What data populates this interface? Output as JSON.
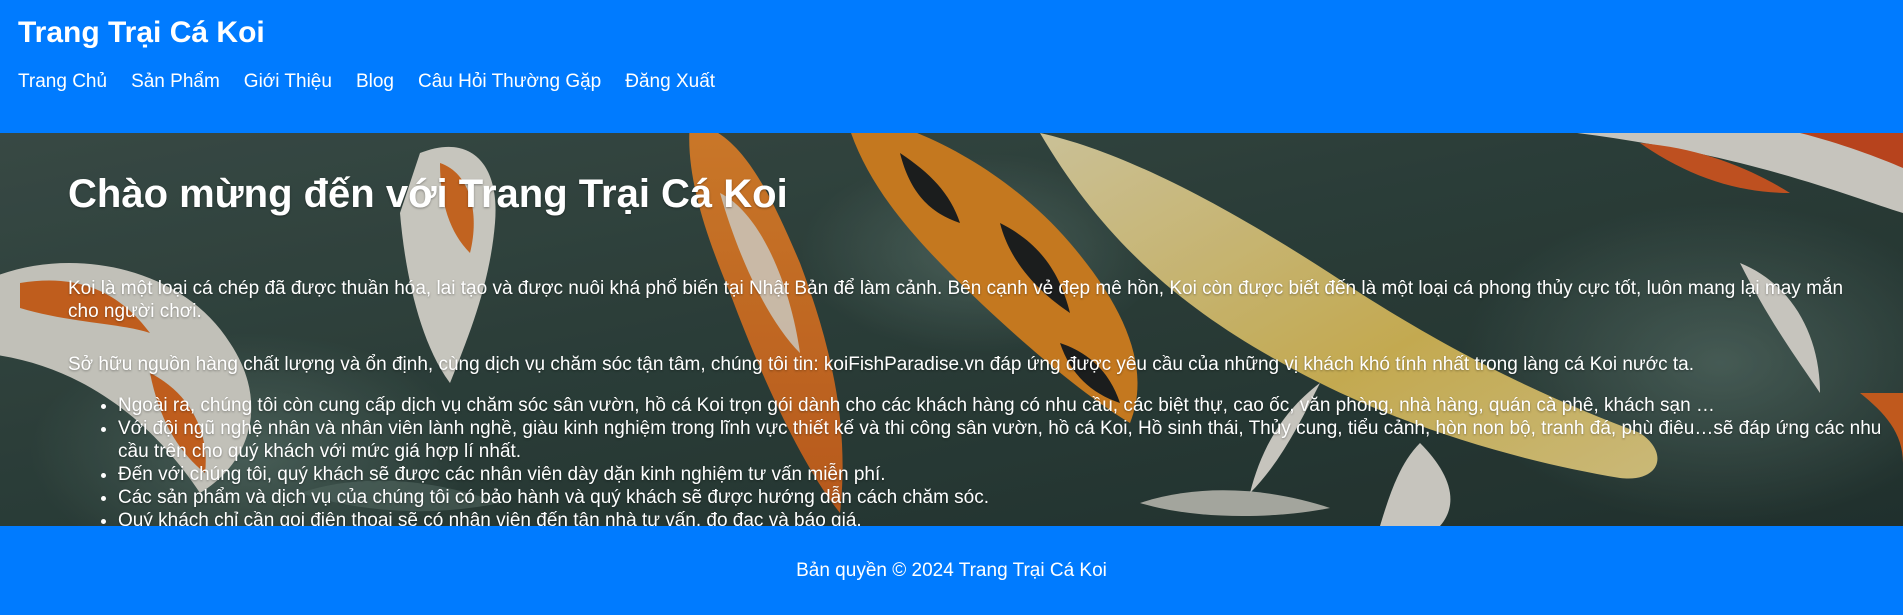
{
  "header": {
    "title": "Trang Trại Cá Koi",
    "nav": [
      {
        "label": "Trang Chủ"
      },
      {
        "label": "Sản Phẩm"
      },
      {
        "label": "Giới Thiệu"
      },
      {
        "label": "Blog"
      },
      {
        "label": "Câu Hỏi Thường Gặp"
      },
      {
        "label": "Đăng Xuất"
      }
    ]
  },
  "hero": {
    "heading": "Chào mừng đến với Trang Trại Cá Koi",
    "paragraph1": "Koi là một loại cá chép đã được thuần hóa, lai tạo và được nuôi khá phổ biến tại Nhật Bản để làm cảnh. Bên cạnh vẻ đẹp mê hồn, Koi còn được biết đến là một loại cá phong thủy cực tốt, luôn mang lại may mắn cho người chơi.",
    "paragraph2": "Sở hữu nguồn hàng chất lượng và ổn định, cùng dịch vụ chăm sóc tận tâm, chúng tôi tin: koiFishParadise.vn đáp ứng được yêu cầu của những vị khách khó tính nhất trong làng cá Koi nước ta.",
    "list": [
      "Ngoài ra, chúng tôi còn cung cấp dịch vụ chăm sóc sân vườn, hồ cá Koi trọn gói dành cho các khách hàng có nhu cầu, các biệt thự, cao ốc, văn phòng, nhà hàng, quán cà phê, khách sạn …",
      "Với đội ngũ nghệ nhân và nhân viên lành nghề, giàu kinh nghiệm trong lĩnh vực thiết kế và thi công sân vườn, hồ cá Koi, Hồ sinh thái, Thủy cung, tiểu cảnh, hòn non bộ, tranh đá, phù điêu…sẽ đáp ứng các nhu cầu trên cho quý khách với mức giá hợp lí nhất.",
      "Đến với chúng tôi, quý khách sẽ được các nhân viên dày dặn kinh nghiệm tư vấn miễn phí.",
      "Các sản phẩm và dịch vụ của chúng tôi có bảo hành và quý khách sẽ được hướng dẫn cách chăm sóc.",
      "Quý khách chỉ cần gọi điện thoại sẽ có nhân viên đến tận nhà tư vấn, đo đạc và báo giá."
    ]
  },
  "footer": {
    "copyright": "Bản quyền © 2024 Trang Trại Cá Koi"
  },
  "colors": {
    "primary": "#007bff",
    "text": "#ffffff",
    "water_dark": "#2c3f3a",
    "koi_orange": "#e8701e",
    "koi_yellow": "#e9c85a",
    "koi_white": "#ece7df"
  }
}
